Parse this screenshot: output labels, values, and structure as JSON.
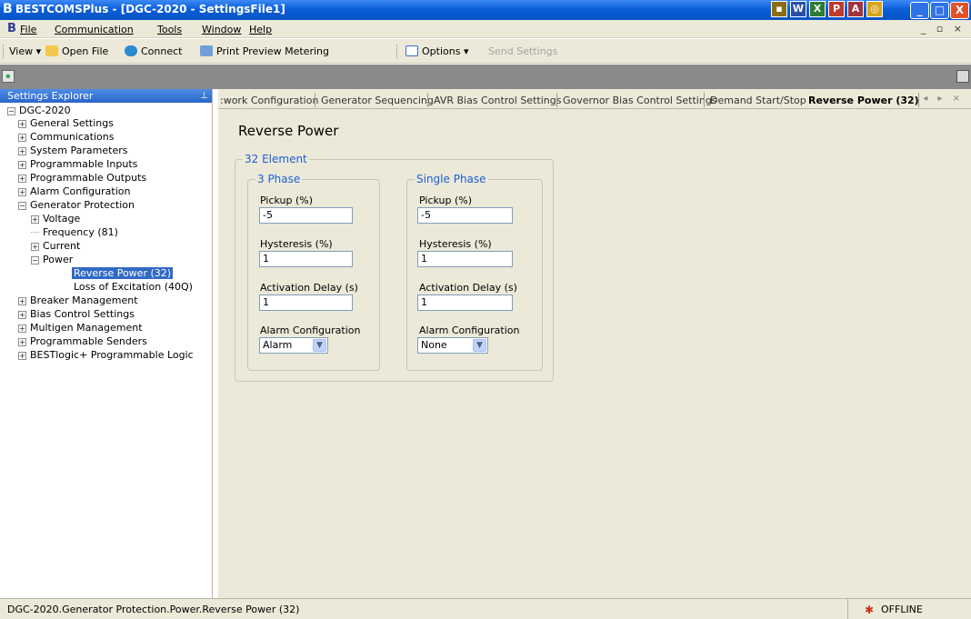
{
  "window": {
    "title": "BESTCOMSPlus - [DGC-2020 - SettingsFile1]",
    "min": "_",
    "max": "□",
    "close": "X"
  },
  "menu": {
    "items": [
      "File",
      "Communication",
      "Tools",
      "Window",
      "Help"
    ]
  },
  "toolbar": {
    "view": "View",
    "open_file": "Open File",
    "connect": "Connect",
    "print_preview": "Print Preview Metering",
    "options": "Options",
    "send_settings": "Send Settings"
  },
  "explorer": {
    "header": "Settings Explorer",
    "root": "DGC-2020",
    "items": [
      "General Settings",
      "Communications",
      "System Parameters",
      "Programmable Inputs",
      "Programmable Outputs",
      "Alarm Configuration",
      "Generator Protection",
      "Voltage",
      "Frequency (81)",
      "Current",
      "Power",
      "Reverse Power (32)",
      "Loss of Excitation (40Q)",
      "Breaker Management",
      "Bias Control Settings",
      "Multigen Management",
      "Programmable Senders",
      "BESTlogic+ Programmable Logic"
    ]
  },
  "tabs": {
    "items": [
      ":work Configuration",
      "Generator Sequencing",
      "AVR Bias Control Settings",
      "Governor Bias Control Settings",
      "Demand Start/Stop",
      "Reverse Power (32)"
    ]
  },
  "panel": {
    "title": "Reverse Power",
    "element_group": "32 Element",
    "three_phase": {
      "title": "3 Phase",
      "pickup_label": "Pickup (%)",
      "pickup_value": "-5",
      "hysteresis_label": "Hysteresis (%)",
      "hysteresis_value": "1",
      "delay_label": "Activation Delay (s)",
      "delay_value": "1",
      "alarm_label": "Alarm Configuration",
      "alarm_value": "Alarm"
    },
    "single_phase": {
      "title": "Single Phase",
      "pickup_label": "Pickup (%)",
      "pickup_value": "-5",
      "hysteresis_label": "Hysteresis (%)",
      "hysteresis_value": "1",
      "delay_label": "Activation Delay (s)",
      "delay_value": "1",
      "alarm_label": "Alarm Configuration",
      "alarm_value": "None"
    }
  },
  "status": {
    "path": "DGC-2020.Generator Protection.Power.Reverse Power (32)",
    "connection": "OFFLINE"
  },
  "colors": {
    "title_bar": "#0a5fd8",
    "accent_blue": "#1c5fd6",
    "selected": "#316ac5"
  }
}
